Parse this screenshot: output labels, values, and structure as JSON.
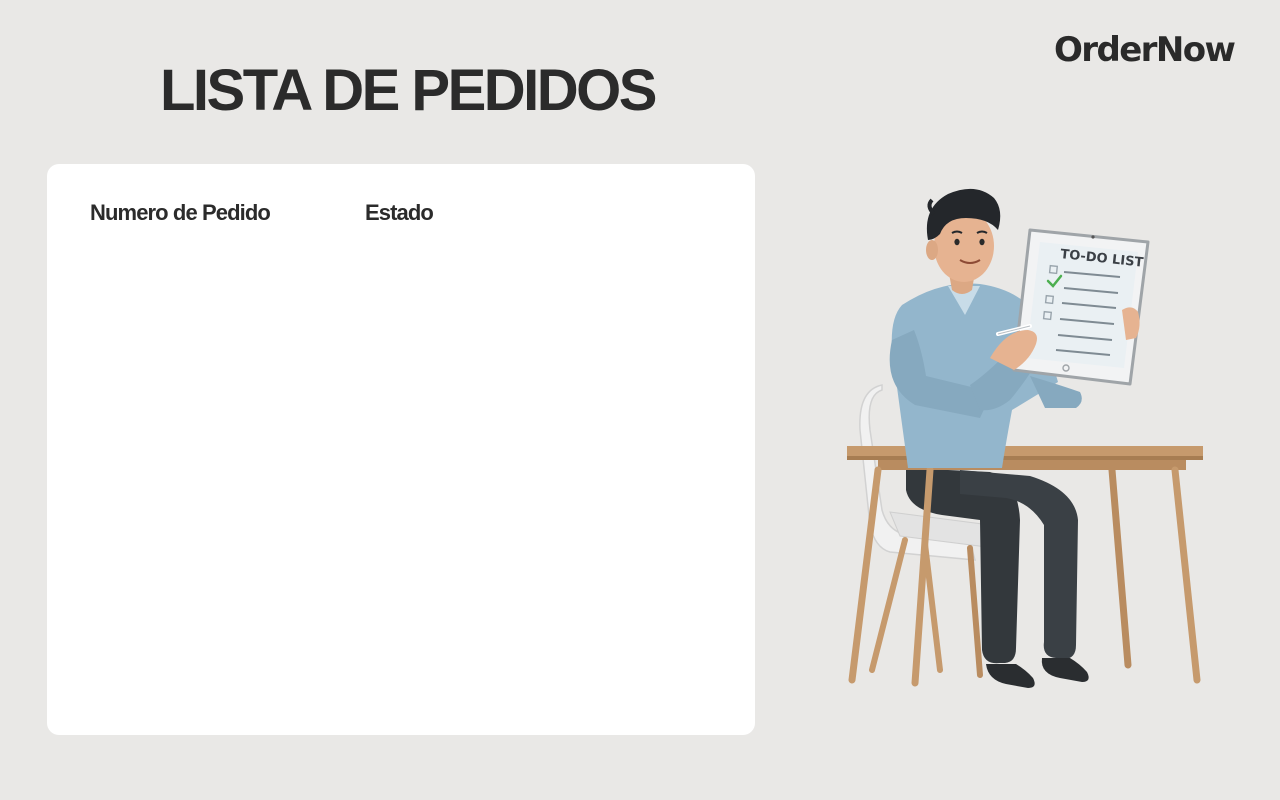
{
  "brand": {
    "name": "OrderNow"
  },
  "page": {
    "title": "LISTA DE PEDIDOS"
  },
  "orders_table": {
    "columns": [
      "Numero de Pedido",
      "Estado"
    ],
    "rows": []
  },
  "illustration": {
    "tablet_text": "TO-DO LIST"
  },
  "colors": {
    "background": "#e9e8e6",
    "panel": "#ffffff",
    "text": "#2b2b2b",
    "shirt": "#93b6cc",
    "pants": "#33383c",
    "wood": "#c69a6d",
    "check": "#4caf50"
  }
}
